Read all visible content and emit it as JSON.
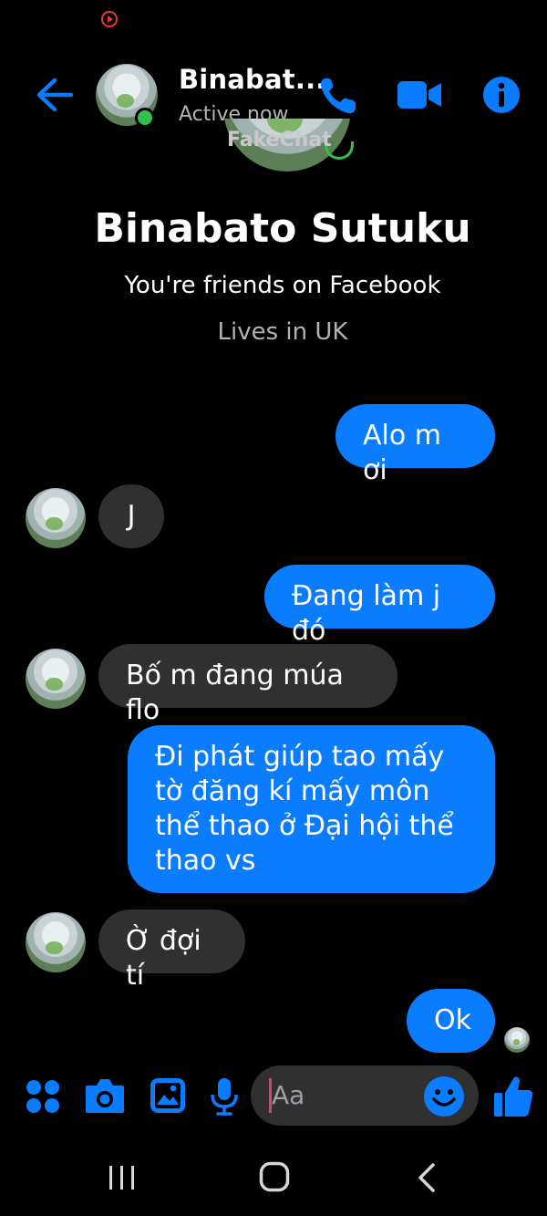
{
  "header": {
    "name": "Binabat...",
    "status": "Active now",
    "watermark": "FakeChat"
  },
  "profile": {
    "name": "Binabato Sutuku",
    "friends_text": "You're friends on Facebook",
    "lives_text": "Lives in UK"
  },
  "messages": [
    {
      "from": "me",
      "text": "Alo m ơi"
    },
    {
      "from": "them",
      "text": "J"
    },
    {
      "from": "me",
      "text": "Đang làm j đó"
    },
    {
      "from": "them",
      "text": "Bố m đang múa flo"
    },
    {
      "from": "me",
      "text": "Đi phát giúp tao mấy tờ đăng kí mấy môn thể thao ở Đại hội thể thao vs"
    },
    {
      "from": "them",
      "text": "Ờ đợi tí"
    },
    {
      "from": "me",
      "text": "Ok"
    }
  ],
  "composer": {
    "placeholder": "Aa"
  },
  "colors": {
    "accent": "#0a7cff",
    "incoming_bubble": "#303030",
    "online": "#31c24d",
    "background": "#000000"
  },
  "icons": [
    "back-arrow-icon",
    "phone-icon",
    "video-camera-icon",
    "info-icon",
    "apps-icon",
    "camera-icon",
    "gallery-icon",
    "microphone-icon",
    "emoji-icon",
    "thumbs-up-icon",
    "recents-icon",
    "home-icon",
    "back-chevron-icon"
  ]
}
